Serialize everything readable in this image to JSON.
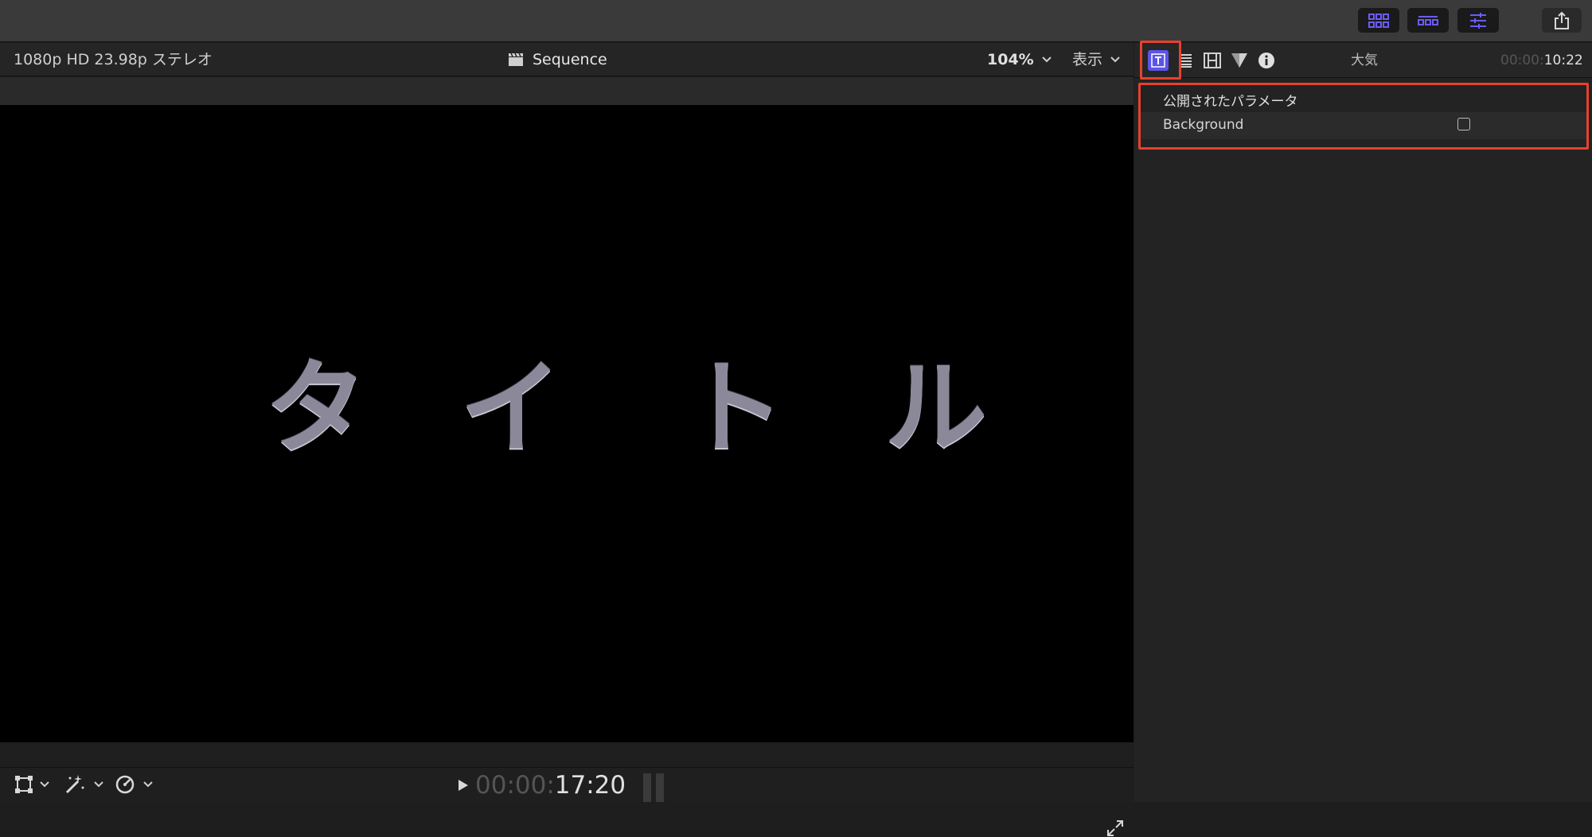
{
  "toolbar": {
    "buttons": [
      "library-grid-icon",
      "timeline-icon",
      "inspector-sliders-icon"
    ],
    "share_icon": "share-icon",
    "accent_color": "#6a5cff"
  },
  "viewer": {
    "format_label": "1080p HD 23.98p ステレオ",
    "sequence_icon": "clapper-icon",
    "sequence_name": "Sequence",
    "zoom_label": "104%",
    "view_menu_label": "表示",
    "canvas_text": [
      "タ",
      "イ",
      "ト",
      "ル"
    ],
    "timecode_dim": "00:00:",
    "timecode_bright": "17:20"
  },
  "inspector": {
    "tabs": [
      "text-icon",
      "text-lines-icon",
      "film-icon",
      "triangle-icon",
      "info-icon"
    ],
    "title": "大気",
    "duration_dim": "00:00:",
    "duration_bright": "10:22",
    "section_label": "公開されたパラメータ",
    "param_name": "Background",
    "param_checked": false,
    "highlight_color": "#e8412d"
  }
}
